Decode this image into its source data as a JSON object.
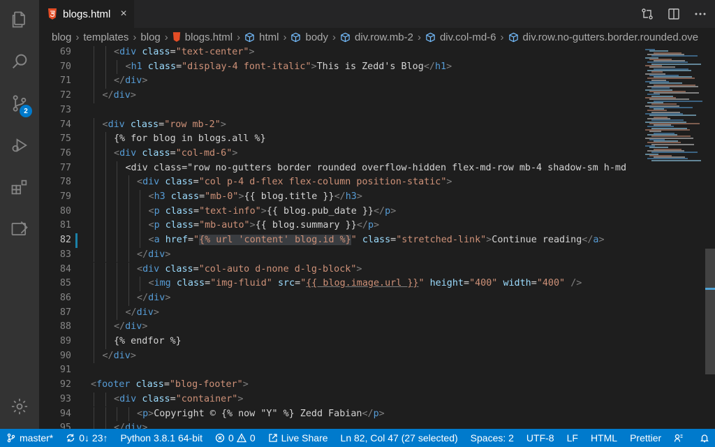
{
  "tab": {
    "label": "blogs.html",
    "close": "×"
  },
  "breadcrumb": [
    "blog",
    "templates",
    "blog",
    "blogs.html",
    "html",
    "body",
    "div.row.mb-2",
    "div.col-md-6",
    "div.row.no-gutters.border.rounded.ove"
  ],
  "activity": {
    "scm_badge": "2"
  },
  "colors": {
    "accent": "#007acc",
    "tag": "#569cd6",
    "attr": "#9cdcfe",
    "string": "#ce9178",
    "text": "#d4d4d4"
  },
  "editor": {
    "active_line": 82,
    "lines": [
      {
        "n": "69",
        "indent": 2,
        "code": "<div class=\"text-center\">"
      },
      {
        "n": "70",
        "indent": 3,
        "code": "<h1 class=\"display-4 font-italic\">This is Zedd's Blog</h1>"
      },
      {
        "n": "71",
        "indent": 2,
        "code": "</div>"
      },
      {
        "n": "72",
        "indent": 1,
        "code": "</div>"
      },
      {
        "n": "73",
        "indent": 0,
        "code": ""
      },
      {
        "n": "74",
        "indent": 1,
        "code": "<div class=\"row mb-2\">"
      },
      {
        "n": "75",
        "indent": 2,
        "code": "{% for blog in blogs.all %}"
      },
      {
        "n": "76",
        "indent": 2,
        "code": "<div class=\"col-md-6\">"
      },
      {
        "n": "77",
        "indent": 3,
        "code": "<div class=\"row no-gutters border rounded overflow-hidden flex-md-row mb-4 shadow-sm h-md"
      },
      {
        "n": "78",
        "indent": 4,
        "code": "<div class=\"col p-4 d-flex flex-column position-static\">"
      },
      {
        "n": "79",
        "indent": 5,
        "code": "<h3 class=\"mb-0\">{{ blog.title }}</h3>"
      },
      {
        "n": "80",
        "indent": 5,
        "code": "<p class=\"text-info\">{{ blog.pub_date }}</p>"
      },
      {
        "n": "81",
        "indent": 5,
        "code": "<p class=\"mb-auto\">{{ blog.summary }}</p>"
      },
      {
        "n": "82",
        "indent": 5,
        "code": "<a href=\"{% url 'content' blog.id %}\" class=\"stretched-link\">Continue reading</a>"
      },
      {
        "n": "83",
        "indent": 4,
        "code": "</div>"
      },
      {
        "n": "84",
        "indent": 4,
        "code": "<div class=\"col-auto d-none d-lg-block\">"
      },
      {
        "n": "85",
        "indent": 5,
        "code": "<img class=\"img-fluid\" src=\"{{ blog.image.url }}\" height=\"400\" width=\"400\" />"
      },
      {
        "n": "86",
        "indent": 4,
        "code": "</div>"
      },
      {
        "n": "87",
        "indent": 3,
        "code": "</div>"
      },
      {
        "n": "88",
        "indent": 2,
        "code": "</div>"
      },
      {
        "n": "89",
        "indent": 2,
        "code": "{% endfor %}"
      },
      {
        "n": "90",
        "indent": 1,
        "code": "</div>"
      },
      {
        "n": "91",
        "indent": 0,
        "code": ""
      },
      {
        "n": "92",
        "indent": 0,
        "code": "<footer class=\"blog-footer\">"
      },
      {
        "n": "93",
        "indent": 2,
        "code": "<div class=\"container\">"
      },
      {
        "n": "94",
        "indent": 4,
        "code": "<p>Copyright © {% now \"Y\" %} Zedd Fabian</p>"
      },
      {
        "n": "95",
        "indent": 2,
        "code": "</div>"
      }
    ]
  },
  "status": {
    "branch": "master*",
    "sync": "0↓ 23↑",
    "python": "Python 3.8.1 64-bit",
    "errors": "0",
    "warnings": "0",
    "live_share": "Live Share",
    "position": "Ln 82, Col 47 (27 selected)",
    "spaces": "Spaces: 2",
    "encoding": "UTF-8",
    "eol": "LF",
    "language": "HTML",
    "formatter": "Prettier"
  }
}
